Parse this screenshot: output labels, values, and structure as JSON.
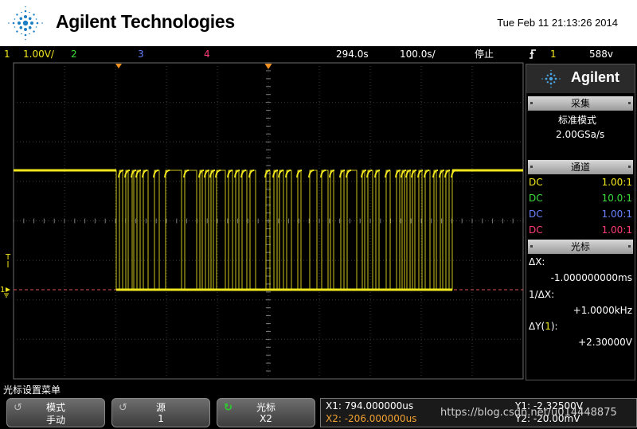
{
  "header": {
    "brand": "Agilent Technologies",
    "datetime": "Tue Feb 11 21:13:26 2014"
  },
  "status_bar": {
    "ch1_num": "1",
    "ch1_scale": "1.00V/",
    "ch2_num": "2",
    "ch3_num": "3",
    "ch4_num": "4",
    "time_delay": "294.0s",
    "time_scale": "100.0s/",
    "run_state": "停止",
    "trigger_icon": "trigger-edge-icon",
    "trigger_source": "1",
    "trigger_level": "588v"
  },
  "scope": {
    "trace_color": "#f0e61e",
    "trigger_marker": "T",
    "ch1_marker": "1"
  },
  "panel": {
    "logo": "Agilent",
    "acq_title": "采集",
    "acq_mode": "标准模式",
    "acq_rate": "2.00GSa/s",
    "channels_title": "通道",
    "channels": [
      {
        "coupling": "DC",
        "probe": "1.00:1",
        "color": "#f0e61e"
      },
      {
        "coupling": "DC",
        "probe": "10.0:1",
        "color": "#3cdc3c"
      },
      {
        "coupling": "DC",
        "probe": "1.00:1",
        "color": "#6a82ff"
      },
      {
        "coupling": "DC",
        "probe": "1.00:1",
        "color": "#ff3c78"
      }
    ],
    "cursor_title": "光标",
    "dx_label": "ΔX:",
    "dx_value": "-1.000000000ms",
    "inv_dx_label": "1/ΔX:",
    "inv_dx_value": "+1.0000kHz",
    "dy_label": "ΔY(",
    "dy_ch": "1",
    "dy_close": "):",
    "dy_value": "+2.30000V"
  },
  "softkeys": {
    "menu_title": "光标设置菜单",
    "mode_label": "模式",
    "mode_value": "手动",
    "source_label": "源",
    "source_value": "1",
    "cursor_label": "光标",
    "cursor_value": "X2"
  },
  "readout": {
    "x1": "X1: 794.000000us",
    "x2": "X2: -206.000000us",
    "y1": "Y1: -2.32500V",
    "y2": "Y2: -20.00mV"
  },
  "watermark": "https://blog.csdn.net/u014448875"
}
